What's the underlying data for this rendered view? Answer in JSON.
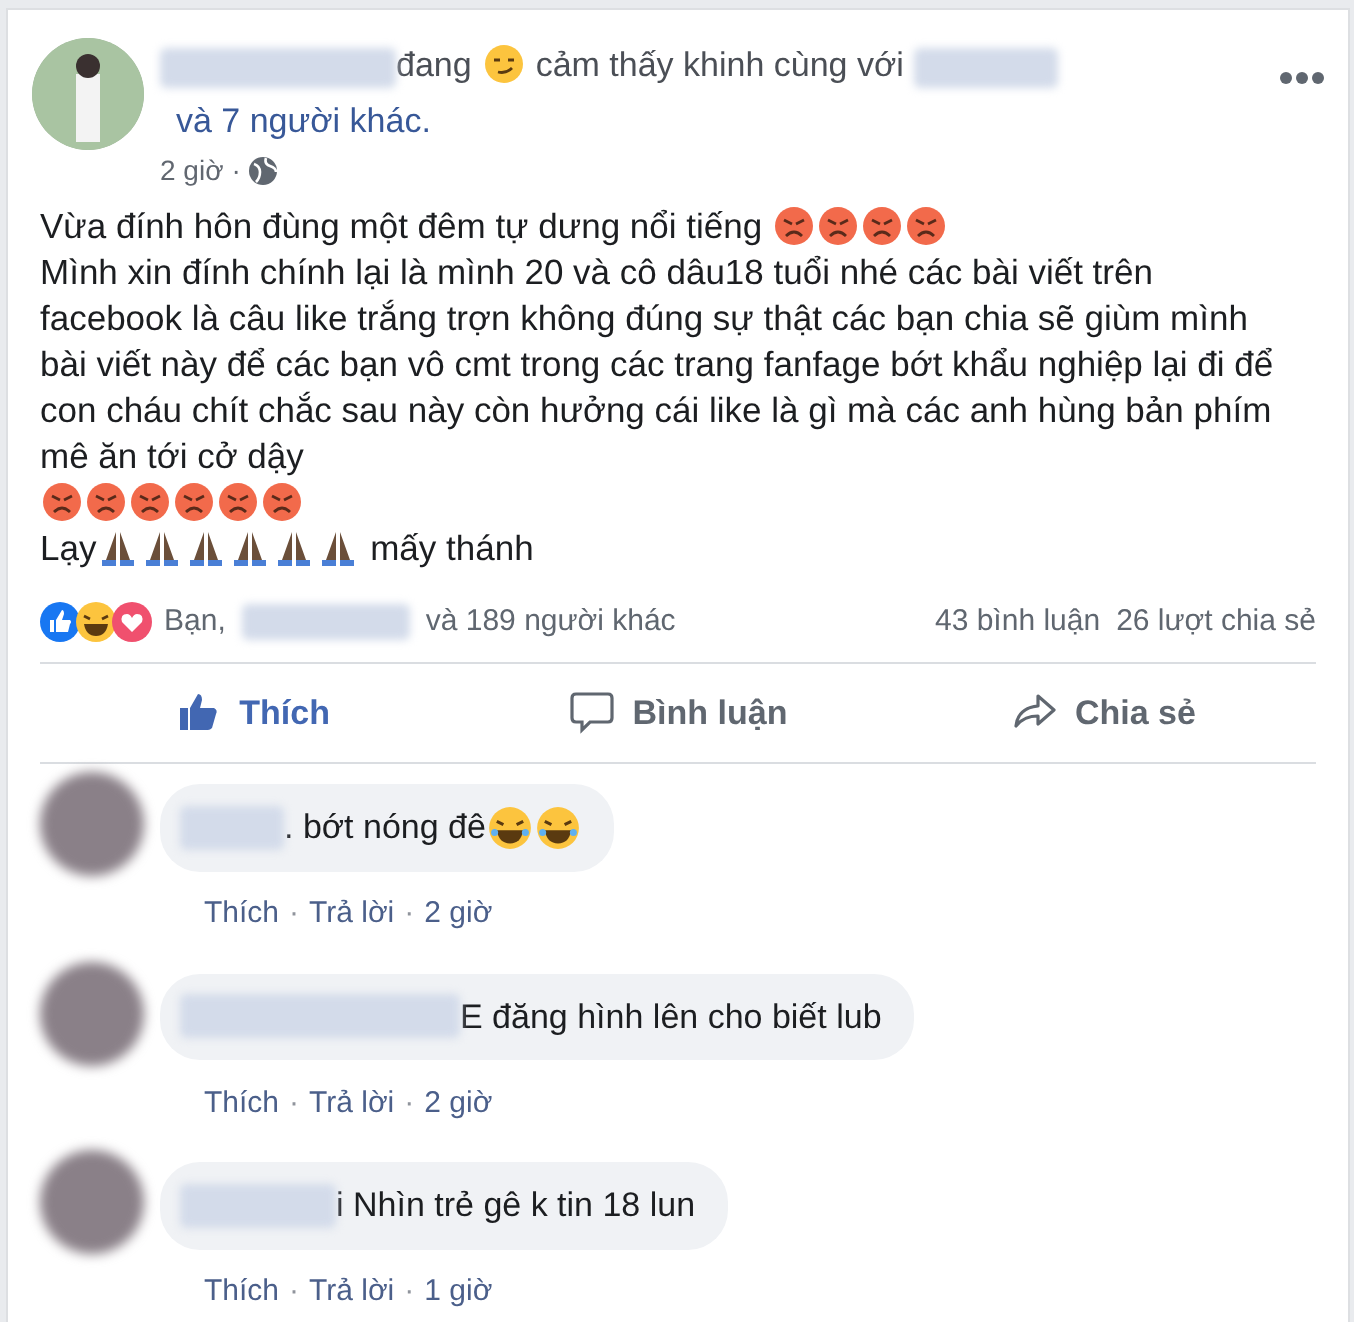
{
  "post": {
    "header": {
      "feeling_verb": "đang",
      "feeling_icon": {
        "kind": "smirk"
      },
      "feeling": "cảm thấy khinh cùng với",
      "others": "và 7 người khác.",
      "time": "2 giờ",
      "separator": "·"
    },
    "paragraphs": [
      [
        {
          "kind": "text",
          "text": "Vừa đính hôn đùng một đêm tự dưng nổi tiếng "
        },
        {
          "kind": "angry"
        },
        {
          "kind": "angry"
        },
        {
          "kind": "angry"
        },
        {
          "kind": "angry"
        }
      ],
      [
        {
          "kind": "text",
          "text": "Mình xin đính chính lại là mình 20 và cô dâu18 tuổi nhé các bài viết trên facebook là câu like trắng trợn không đúng sự thật các bạn chia sẽ giùm mình bài viết này để các bạn vô cmt trong các trang fanfage bớt khẩu nghiệp lại đi để con cháu chít chắc sau này còn hưởng cái like là gì mà các anh hùng bản phím mê ăn tới cở dậy"
        },
        {
          "kind": "angry"
        },
        {
          "kind": "angry"
        },
        {
          "kind": "angry"
        },
        {
          "kind": "angry"
        },
        {
          "kind": "angry"
        },
        {
          "kind": "angry"
        }
      ],
      [
        {
          "kind": "text",
          "text": "Lạy"
        },
        {
          "kind": "pray"
        },
        {
          "kind": "pray"
        },
        {
          "kind": "pray"
        },
        {
          "kind": "pray"
        },
        {
          "kind": "pray"
        },
        {
          "kind": "pray"
        },
        {
          "kind": "text",
          "text": " mấy thánh"
        }
      ]
    ],
    "reactions": {
      "icons": [
        {
          "kind": "like"
        },
        {
          "kind": "haha"
        },
        {
          "kind": "love"
        }
      ],
      "prefix": "Bạn,",
      "suffix": "và 189 người khác",
      "comments": "43 bình luận",
      "shares": "26 lượt chia sẻ"
    },
    "actions": [
      {
        "kind": "like",
        "label": "Thích",
        "selected": true
      },
      {
        "kind": "comment",
        "label": "Bình luận",
        "selected": false
      },
      {
        "kind": "share",
        "label": "Chia sẻ",
        "selected": false
      }
    ]
  },
  "comments": [
    {
      "text": ". bớt nóng đê ",
      "emojis": [
        {
          "kind": "laugh"
        },
        {
          "kind": "laugh"
        }
      ],
      "like": "Thích",
      "separator_1": "·",
      "reply": "Trả lời",
      "separator_2": "·",
      "time": "2 giờ"
    },
    {
      "text": "E đăng hình lên cho biết lub",
      "like": "Thích",
      "separator_1": "·",
      "reply": "Trả lời",
      "separator_2": "·",
      "time": "2 giờ"
    },
    {
      "text": "i Nhìn trẻ gê k tin 18 lun",
      "like": "Thích",
      "separator_1": "·",
      "reply": "Trả lời",
      "separator_2": "·",
      "time": "1 giờ"
    }
  ]
}
